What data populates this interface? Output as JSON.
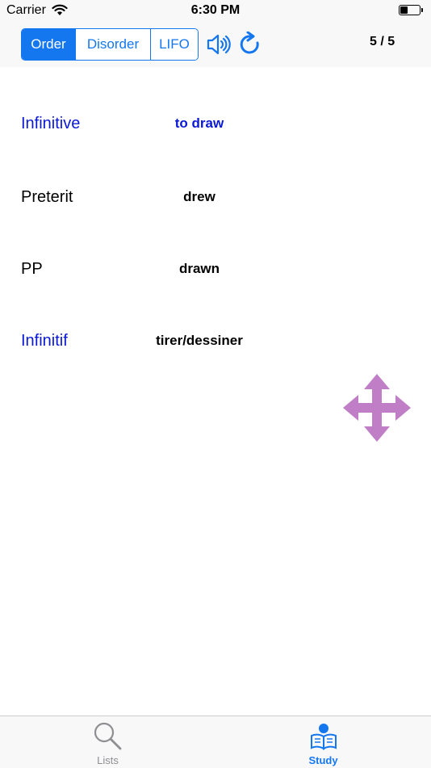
{
  "status_bar": {
    "carrier": "Carrier",
    "time": "6:30 PM"
  },
  "toolbar": {
    "segments": [
      "Order",
      "Disorder",
      "LIFO"
    ],
    "selected_segment": "Order",
    "counter": "5 / 5"
  },
  "rows": [
    {
      "label": "Infinitive",
      "value": "to draw",
      "label_color": "#0a19d6",
      "value_color": "#0a19d6"
    },
    {
      "label": "Preterit",
      "value": "drew",
      "label_color": "#000000",
      "value_color": "#000000"
    },
    {
      "label": "PP",
      "value": "drawn",
      "label_color": "#000000",
      "value_color": "#000000"
    },
    {
      "label": "Infinitif",
      "value": "tirer/dessiner",
      "label_color": "#0a19d6",
      "value_color": "#000000"
    }
  ],
  "icons": [
    "wifi-icon",
    "speaker-icon",
    "refresh-icon",
    "move-icon",
    "search-icon",
    "study-book-icon"
  ],
  "colors": {
    "accent": "#1577f0",
    "move_icon": "#c07ec6",
    "label_blue": "#0a19d6"
  },
  "tabbar": {
    "tabs": [
      {
        "label": "Lists",
        "selected": false
      },
      {
        "label": "Study",
        "selected": true
      }
    ]
  }
}
